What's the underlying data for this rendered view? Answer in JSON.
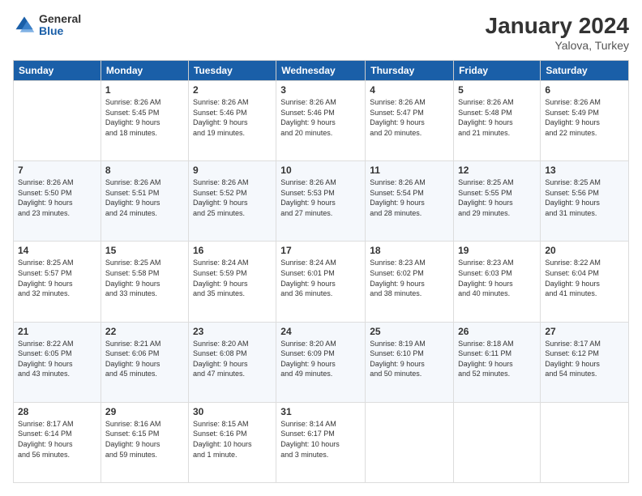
{
  "header": {
    "logo": {
      "line1": "General",
      "line2": "Blue"
    },
    "title": "January 2024",
    "location": "Yalova, Turkey"
  },
  "weekdays": [
    "Sunday",
    "Monday",
    "Tuesday",
    "Wednesday",
    "Thursday",
    "Friday",
    "Saturday"
  ],
  "weeks": [
    [
      {
        "day": "",
        "info": ""
      },
      {
        "day": "1",
        "info": "Sunrise: 8:26 AM\nSunset: 5:45 PM\nDaylight: 9 hours\nand 18 minutes."
      },
      {
        "day": "2",
        "info": "Sunrise: 8:26 AM\nSunset: 5:46 PM\nDaylight: 9 hours\nand 19 minutes."
      },
      {
        "day": "3",
        "info": "Sunrise: 8:26 AM\nSunset: 5:46 PM\nDaylight: 9 hours\nand 20 minutes."
      },
      {
        "day": "4",
        "info": "Sunrise: 8:26 AM\nSunset: 5:47 PM\nDaylight: 9 hours\nand 20 minutes."
      },
      {
        "day": "5",
        "info": "Sunrise: 8:26 AM\nSunset: 5:48 PM\nDaylight: 9 hours\nand 21 minutes."
      },
      {
        "day": "6",
        "info": "Sunrise: 8:26 AM\nSunset: 5:49 PM\nDaylight: 9 hours\nand 22 minutes."
      }
    ],
    [
      {
        "day": "7",
        "info": "Sunrise: 8:26 AM\nSunset: 5:50 PM\nDaylight: 9 hours\nand 23 minutes."
      },
      {
        "day": "8",
        "info": "Sunrise: 8:26 AM\nSunset: 5:51 PM\nDaylight: 9 hours\nand 24 minutes."
      },
      {
        "day": "9",
        "info": "Sunrise: 8:26 AM\nSunset: 5:52 PM\nDaylight: 9 hours\nand 25 minutes."
      },
      {
        "day": "10",
        "info": "Sunrise: 8:26 AM\nSunset: 5:53 PM\nDaylight: 9 hours\nand 27 minutes."
      },
      {
        "day": "11",
        "info": "Sunrise: 8:26 AM\nSunset: 5:54 PM\nDaylight: 9 hours\nand 28 minutes."
      },
      {
        "day": "12",
        "info": "Sunrise: 8:25 AM\nSunset: 5:55 PM\nDaylight: 9 hours\nand 29 minutes."
      },
      {
        "day": "13",
        "info": "Sunrise: 8:25 AM\nSunset: 5:56 PM\nDaylight: 9 hours\nand 31 minutes."
      }
    ],
    [
      {
        "day": "14",
        "info": "Sunrise: 8:25 AM\nSunset: 5:57 PM\nDaylight: 9 hours\nand 32 minutes."
      },
      {
        "day": "15",
        "info": "Sunrise: 8:25 AM\nSunset: 5:58 PM\nDaylight: 9 hours\nand 33 minutes."
      },
      {
        "day": "16",
        "info": "Sunrise: 8:24 AM\nSunset: 5:59 PM\nDaylight: 9 hours\nand 35 minutes."
      },
      {
        "day": "17",
        "info": "Sunrise: 8:24 AM\nSunset: 6:01 PM\nDaylight: 9 hours\nand 36 minutes."
      },
      {
        "day": "18",
        "info": "Sunrise: 8:23 AM\nSunset: 6:02 PM\nDaylight: 9 hours\nand 38 minutes."
      },
      {
        "day": "19",
        "info": "Sunrise: 8:23 AM\nSunset: 6:03 PM\nDaylight: 9 hours\nand 40 minutes."
      },
      {
        "day": "20",
        "info": "Sunrise: 8:22 AM\nSunset: 6:04 PM\nDaylight: 9 hours\nand 41 minutes."
      }
    ],
    [
      {
        "day": "21",
        "info": "Sunrise: 8:22 AM\nSunset: 6:05 PM\nDaylight: 9 hours\nand 43 minutes."
      },
      {
        "day": "22",
        "info": "Sunrise: 8:21 AM\nSunset: 6:06 PM\nDaylight: 9 hours\nand 45 minutes."
      },
      {
        "day": "23",
        "info": "Sunrise: 8:20 AM\nSunset: 6:08 PM\nDaylight: 9 hours\nand 47 minutes."
      },
      {
        "day": "24",
        "info": "Sunrise: 8:20 AM\nSunset: 6:09 PM\nDaylight: 9 hours\nand 49 minutes."
      },
      {
        "day": "25",
        "info": "Sunrise: 8:19 AM\nSunset: 6:10 PM\nDaylight: 9 hours\nand 50 minutes."
      },
      {
        "day": "26",
        "info": "Sunrise: 8:18 AM\nSunset: 6:11 PM\nDaylight: 9 hours\nand 52 minutes."
      },
      {
        "day": "27",
        "info": "Sunrise: 8:17 AM\nSunset: 6:12 PM\nDaylight: 9 hours\nand 54 minutes."
      }
    ],
    [
      {
        "day": "28",
        "info": "Sunrise: 8:17 AM\nSunset: 6:14 PM\nDaylight: 9 hours\nand 56 minutes."
      },
      {
        "day": "29",
        "info": "Sunrise: 8:16 AM\nSunset: 6:15 PM\nDaylight: 9 hours\nand 59 minutes."
      },
      {
        "day": "30",
        "info": "Sunrise: 8:15 AM\nSunset: 6:16 PM\nDaylight: 10 hours\nand 1 minute."
      },
      {
        "day": "31",
        "info": "Sunrise: 8:14 AM\nSunset: 6:17 PM\nDaylight: 10 hours\nand 3 minutes."
      },
      {
        "day": "",
        "info": ""
      },
      {
        "day": "",
        "info": ""
      },
      {
        "day": "",
        "info": ""
      }
    ]
  ]
}
